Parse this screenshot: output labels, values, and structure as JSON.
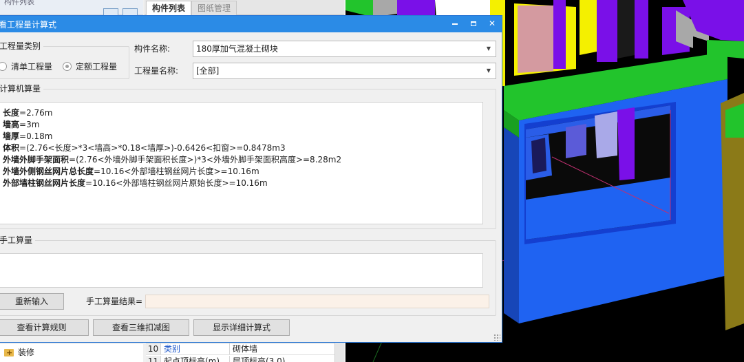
{
  "background": {
    "left_top_label": "构件列表",
    "tabs": [
      {
        "label": "构件列表",
        "active": true
      },
      {
        "label": "图纸管理",
        "active": false
      }
    ],
    "tree_item_label": "装修",
    "grid_rows": [
      {
        "num": "10",
        "name": "类别",
        "value": "砌体墙"
      },
      {
        "num": "11",
        "name": "起点顶标高(m)",
        "value": "层顶标高(3.0)"
      }
    ]
  },
  "dialog": {
    "title": "查看工程量计算式",
    "quantity_type": {
      "label": "工程量类别",
      "options": [
        {
          "label": "清单工程量",
          "checked": false
        },
        {
          "label": "定额工程量",
          "checked": true
        }
      ]
    },
    "component_name": {
      "label": "构件名称:",
      "value": "180厚加气混凝土砌块"
    },
    "quantity_name": {
      "label": "工程量名称:",
      "value": "[全部]"
    },
    "computer_calc": {
      "label": "计算机算量",
      "lines": [
        {
          "key": "长度",
          "expr": "=2.76m"
        },
        {
          "key": "墙高",
          "expr": "=3m"
        },
        {
          "key": "墙厚",
          "expr": "=0.18m"
        },
        {
          "key": "体积",
          "expr": "=(2.76<长度>*3<墙高>*0.18<墙厚>)-0.6426<扣窗>=0.8478m3"
        },
        {
          "key": "外墙外脚手架面积",
          "expr": "=(2.76<外墙外脚手架面积长度>)*3<外墙外脚手架面积高度>=8.28m2"
        },
        {
          "key": "外墙外侧钢丝网片总长度",
          "expr": "=10.16<外部墙柱钢丝网片长度>=10.16m"
        },
        {
          "key": "外部墙柱钢丝网片长度",
          "expr": "=10.16<外部墙柱钢丝网片原始长度>=10.16m"
        }
      ]
    },
    "manual_calc": {
      "label": "手工算量",
      "reenter_button": "重新输入",
      "result_label": "手工算量结果=",
      "result_value": ""
    },
    "buttons": {
      "view_rules": "查看计算规则",
      "view_3d_deduct": "查看三维扣减图",
      "show_detail": "显示详细计算式"
    }
  },
  "colors": {
    "title_bar": "#2b8be6",
    "dialog_bg": "#f0f0f0",
    "wall_blue": "#1f63f2",
    "beam_green": "#22c42c",
    "column_purple": "#7a10e8",
    "slab_yellow": "#f4f000",
    "window_frame": "#2a5de8",
    "wall_pink": "#d49aa0"
  }
}
